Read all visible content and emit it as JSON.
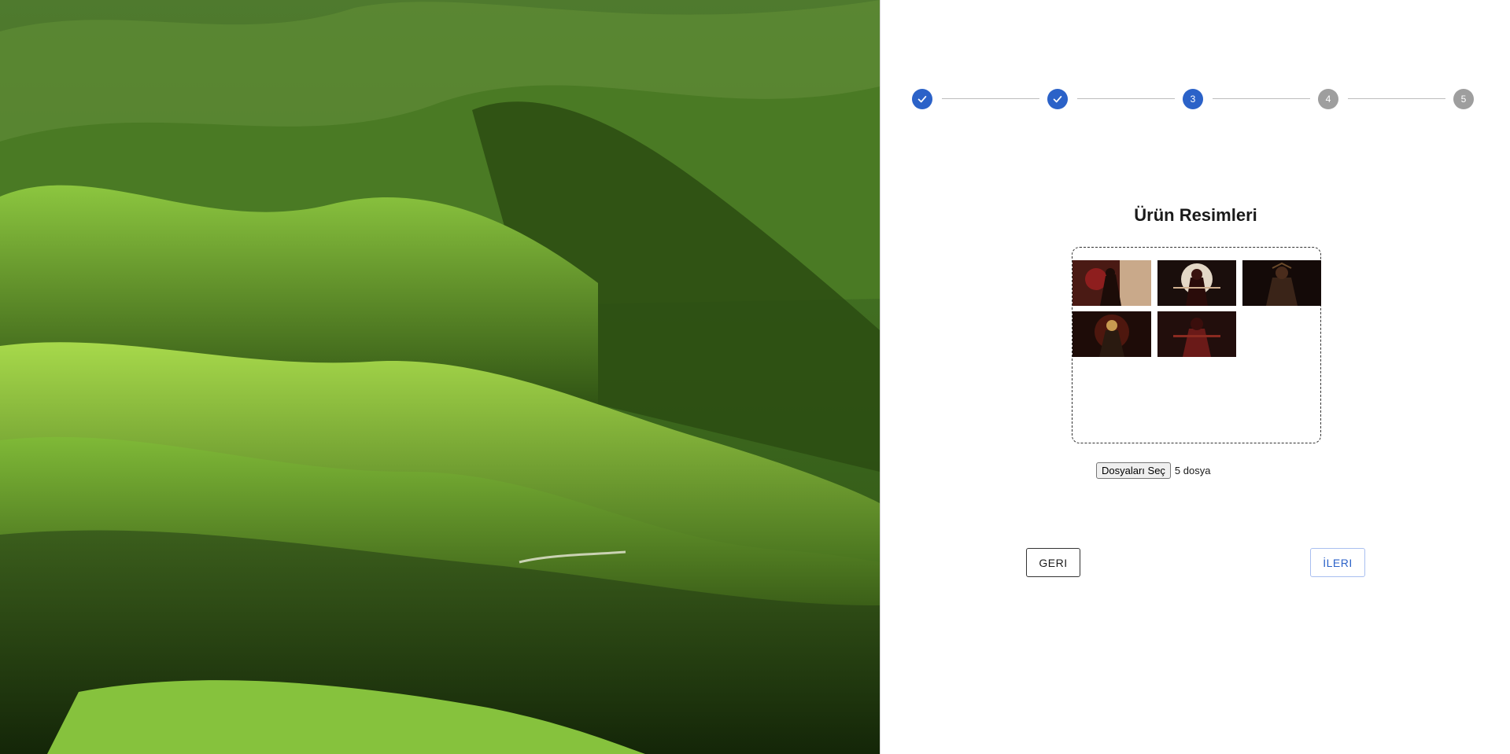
{
  "stepper": {
    "steps": [
      {
        "label": "",
        "state": "completed",
        "icon": "check-icon"
      },
      {
        "label": "",
        "state": "completed",
        "icon": "check-icon"
      },
      {
        "label": "3",
        "state": "active"
      },
      {
        "label": "4",
        "state": "pending"
      },
      {
        "label": "5",
        "state": "pending"
      }
    ],
    "active_color": "#2b62c8",
    "pending_color": "#9e9e9e"
  },
  "form": {
    "title": "Ürün Resimleri",
    "dropzone": {
      "thumbnails": [
        {
          "icon": "samurai-image-thumbnail"
        },
        {
          "icon": "samurai-image-thumbnail"
        },
        {
          "icon": "samurai-image-thumbnail"
        },
        {
          "icon": "samurai-image-thumbnail"
        },
        {
          "icon": "samurai-image-thumbnail"
        }
      ]
    },
    "file_input": {
      "button_label": "Dosyaları Seç",
      "status": "5 dosya"
    }
  },
  "navigation": {
    "back_label": "GERI",
    "next_label": "İLERI"
  },
  "hero": {
    "icon": "green-hills-landscape-image"
  }
}
